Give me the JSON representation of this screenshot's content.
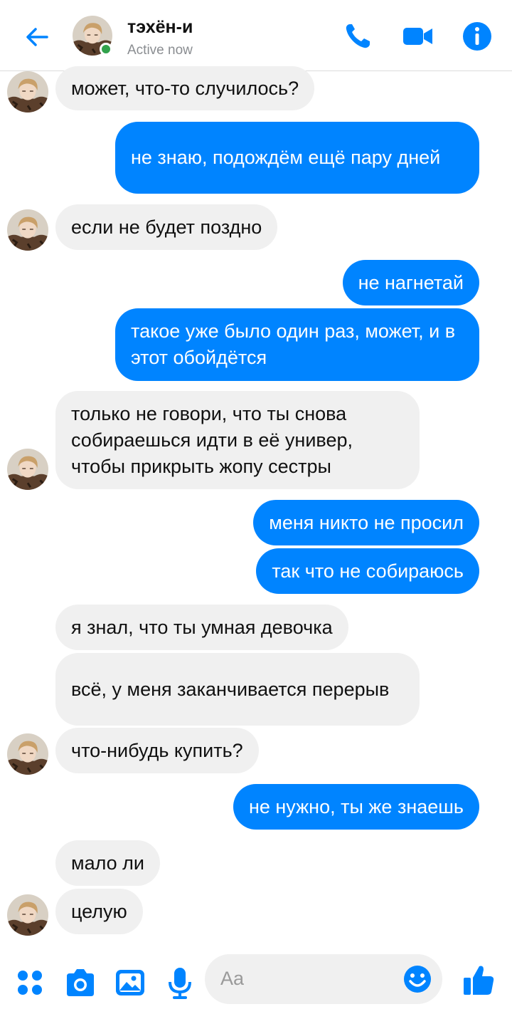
{
  "header": {
    "contact_name": "тэхён-и",
    "status": "Active now",
    "back_icon": "arrow-left-icon",
    "call_icon": "phone-icon",
    "video_icon": "video-camera-icon",
    "info_icon": "info-icon"
  },
  "colors": {
    "accent": "#0084ff",
    "incoming_bubble": "#f0f0f0",
    "online": "#31a24c"
  },
  "messages": [
    {
      "dir": "in",
      "text": "может, что-то случилось?"
    },
    {
      "dir": "out",
      "text": "не знаю, подождём ещё пару дней"
    },
    {
      "dir": "in",
      "text": "если не будет поздно"
    },
    {
      "dir": "out",
      "text": "не нагнетай"
    },
    {
      "dir": "out",
      "text": "такое уже было один раз, может, и в этот обойдётся"
    },
    {
      "dir": "in",
      "text": "только не говори, что ты снова собираешься идти в её универ, чтобы прикрыть жопу сестры"
    },
    {
      "dir": "out",
      "text": "меня никто не просил"
    },
    {
      "dir": "out",
      "text": "так что не собираюсь"
    },
    {
      "dir": "in",
      "text": "я знал, что ты умная девочка"
    },
    {
      "dir": "in",
      "text": "всё, у меня заканчивается перерыв"
    },
    {
      "dir": "in",
      "text": "что-нибудь купить?"
    },
    {
      "dir": "out",
      "text": "не нужно, ты же знаешь"
    },
    {
      "dir": "in",
      "text": "мало ли"
    },
    {
      "dir": "in",
      "text": "целую"
    }
  ],
  "composer": {
    "placeholder": "Aa",
    "icons": [
      "apps-icon",
      "camera-icon",
      "gallery-icon",
      "microphone-icon",
      "emoji-icon",
      "thumbs-up-icon"
    ]
  }
}
